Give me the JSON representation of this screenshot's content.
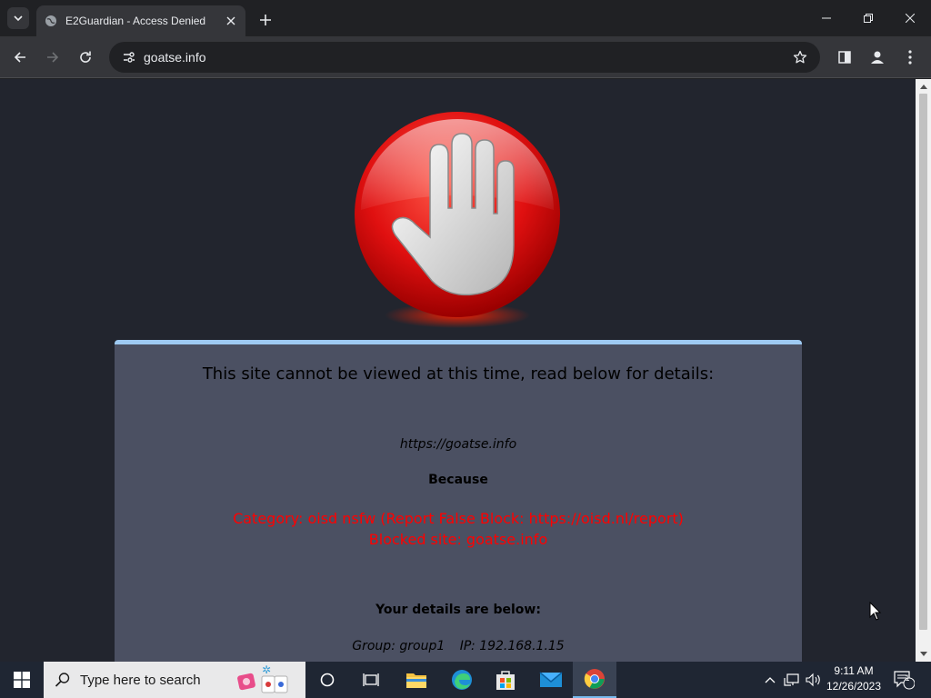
{
  "browser": {
    "tab_title": "E2Guardian - Access Denied",
    "url": "goatse.info"
  },
  "page": {
    "heading": "This site cannot be viewed at this time, read below for details:",
    "blocked_url": "https://goatse.info",
    "because": "Because",
    "reason_line1": "Category: oisd nsfw (Report False Block: https://oisd.nl/report)",
    "reason_line2": "Blocked site: goatse.info",
    "details_heading": "Your details are below:",
    "group": "Group: group1",
    "ip": "IP: 192.168.1.15"
  },
  "taskbar": {
    "search_placeholder": "Type here to search",
    "time": "9:11 AM",
    "date": "12/26/2023",
    "notification_count": "1"
  },
  "colors": {
    "panel_bg": "#4b5062",
    "panel_border": "#9ecaf3",
    "reason_text": "#ff0000",
    "page_bg": "#22252e"
  }
}
